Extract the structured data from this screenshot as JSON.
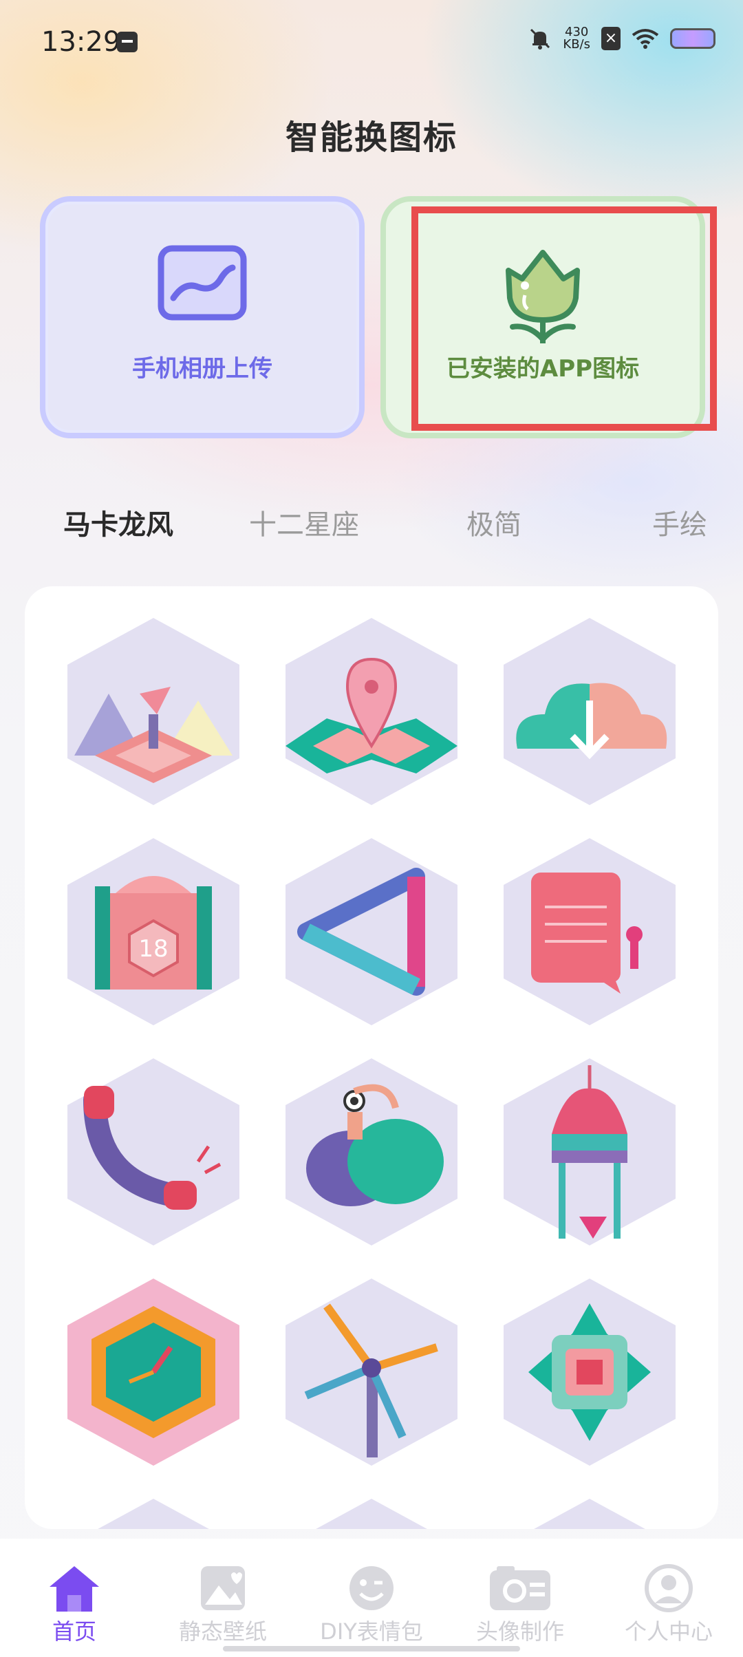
{
  "status_bar": {
    "time": "13:29",
    "net_speed_value": "430",
    "net_speed_unit": "KB/s"
  },
  "page": {
    "title": "智能换图标"
  },
  "cards": [
    {
      "label": "手机相册上传",
      "color": "#6d6ae8"
    },
    {
      "label": "已安装的APP图标",
      "color": "#5d8c3f"
    }
  ],
  "tabs": [
    {
      "label": "马卡龙风",
      "active": true
    },
    {
      "label": "十二星座",
      "active": false
    },
    {
      "label": "极简",
      "active": false
    },
    {
      "label": "手绘",
      "active": false
    }
  ],
  "icon_grid": [
    "mountain-totem-icon",
    "map-pin-icon",
    "cloud-download-icon",
    "calendar-gate-icon",
    "triangle-play-icon",
    "message-note-icon",
    "phone-icon",
    "chat-bubbles-icon",
    "tower-icon",
    "clock-icon",
    "windmill-icon",
    "square-frame-icon"
  ],
  "bottom_nav": [
    {
      "label": "首页",
      "active": true
    },
    {
      "label": "静态壁纸",
      "active": false
    },
    {
      "label": "DIY表情包",
      "active": false
    },
    {
      "label": "头像制作",
      "active": false
    },
    {
      "label": "个人中心",
      "active": false
    }
  ],
  "colors": {
    "accent": "#7b4cf0",
    "highlight": "#e84d4d"
  }
}
